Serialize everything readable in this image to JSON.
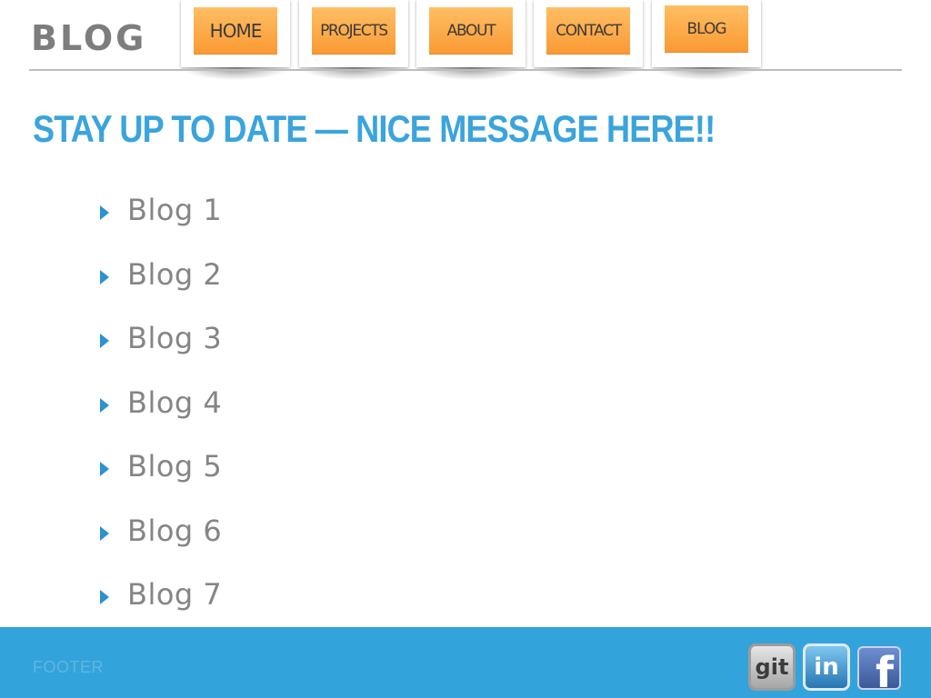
{
  "header": {
    "logo": "BLOG"
  },
  "nav": {
    "items": [
      {
        "label": "HOME"
      },
      {
        "label": "PROJECTS"
      },
      {
        "label": "ABOUT"
      },
      {
        "label": "CONTACT"
      },
      {
        "label": "BLOG"
      }
    ]
  },
  "main": {
    "headline": "STAY UP TO DATE — NICE MESSAGE HERE!!",
    "blogs": [
      {
        "label": "Blog 1"
      },
      {
        "label": "Blog 2"
      },
      {
        "label": "Blog 3"
      },
      {
        "label": "Blog 4"
      },
      {
        "label": "Blog 5"
      },
      {
        "label": "Blog 6"
      },
      {
        "label": "Blog 7"
      }
    ]
  },
  "footer": {
    "text": "FOOTER",
    "social": {
      "git_label": "git",
      "linkedin_label": "in",
      "facebook_label": "f"
    }
  },
  "colors": {
    "accent_blue": "#33a3dc",
    "headline_blue": "#3aa4dc",
    "nav_orange": "#fa9a34",
    "text_gray": "#858585"
  },
  "icons": {
    "bullet": "triangle-right-icon",
    "github": "git-icon",
    "linkedin": "linkedin-icon",
    "facebook": "facebook-icon"
  }
}
